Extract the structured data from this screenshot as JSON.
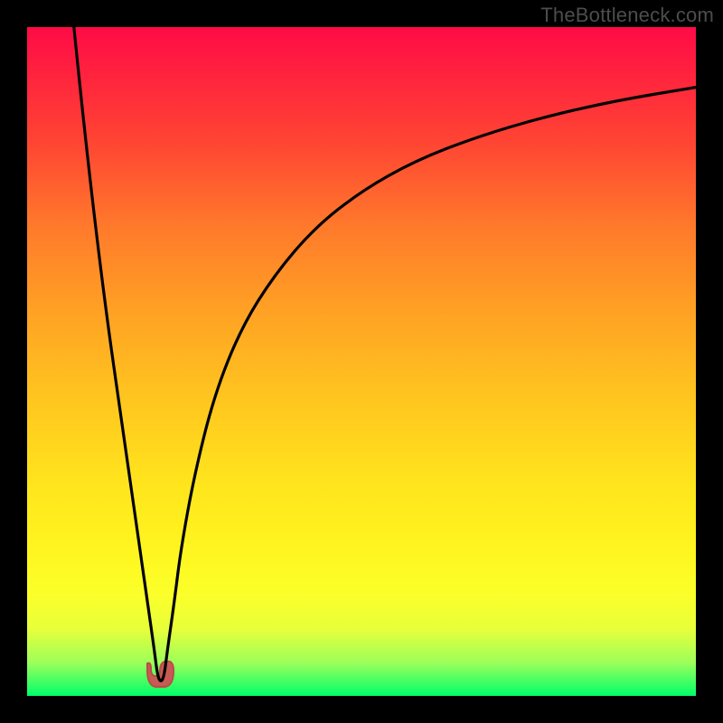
{
  "watermark": "TheBottleneck.com",
  "chart_data": {
    "type": "line",
    "title": "",
    "xlabel": "",
    "ylabel": "",
    "xlim": [
      0,
      100
    ],
    "ylim": [
      0,
      100
    ],
    "grid": false,
    "legend": false,
    "series": [
      {
        "name": "bottleneck-curve",
        "x": [
          7,
          8,
          10,
          12,
          14,
          16,
          17,
          18,
          19,
          19.5,
          20,
          20.5,
          21,
          22,
          23,
          25,
          28,
          32,
          37,
          43,
          50,
          58,
          67,
          77,
          88,
          100
        ],
        "y": [
          100,
          90,
          72,
          56,
          42,
          28,
          21,
          14,
          7,
          3,
          2,
          3,
          7,
          14,
          22,
          33,
          45,
          55,
          63,
          70,
          75.5,
          80,
          83.5,
          86.5,
          89,
          91
        ]
      }
    ],
    "highlight": {
      "name": "min-marker",
      "x": 20,
      "y": 2,
      "color": "#c85a54"
    },
    "gradient_stops": [
      {
        "pos": 0,
        "color": "#ff0b46"
      },
      {
        "pos": 50,
        "color": "#ffc41f"
      },
      {
        "pos": 85,
        "color": "#fbff2a"
      },
      {
        "pos": 100,
        "color": "#00ff6a"
      }
    ]
  }
}
